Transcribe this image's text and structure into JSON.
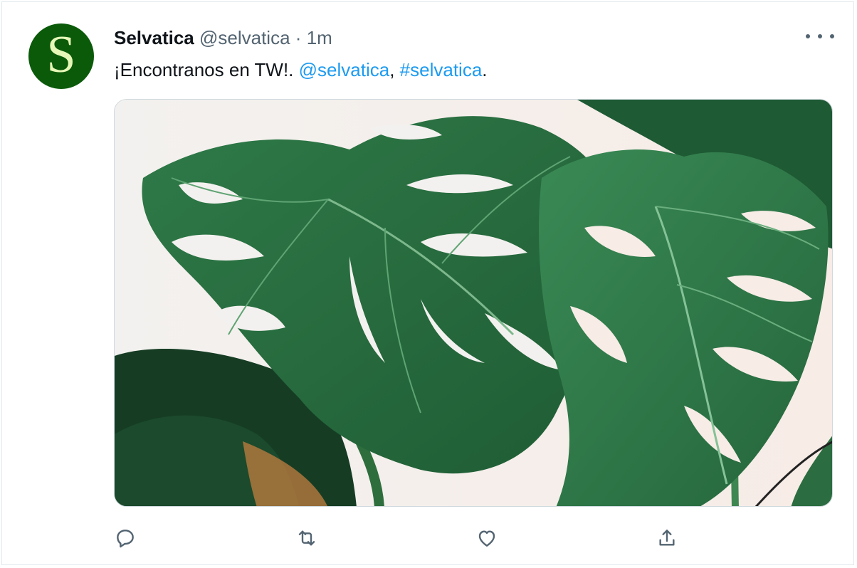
{
  "tweet": {
    "avatar_letter": "S",
    "display_name": "Selvatica",
    "handle": "@selvatica",
    "separator": "·",
    "time": "1m",
    "text_prefix": "¡Encontranos en TW!. ",
    "mention": "@selvatica",
    "comma": ", ",
    "hashtag": "#selvatica",
    "text_suffix": "."
  },
  "icons": {
    "more": "more-options-icon",
    "reply": "reply-icon",
    "retweet": "retweet-icon",
    "like": "heart-icon",
    "share": "share-icon"
  },
  "colors": {
    "link": "#1d9bf0",
    "text": "#0f1419",
    "secondary": "#536471",
    "avatar_bg": "#0a5a0a",
    "avatar_letter": "#e6f7b7"
  }
}
